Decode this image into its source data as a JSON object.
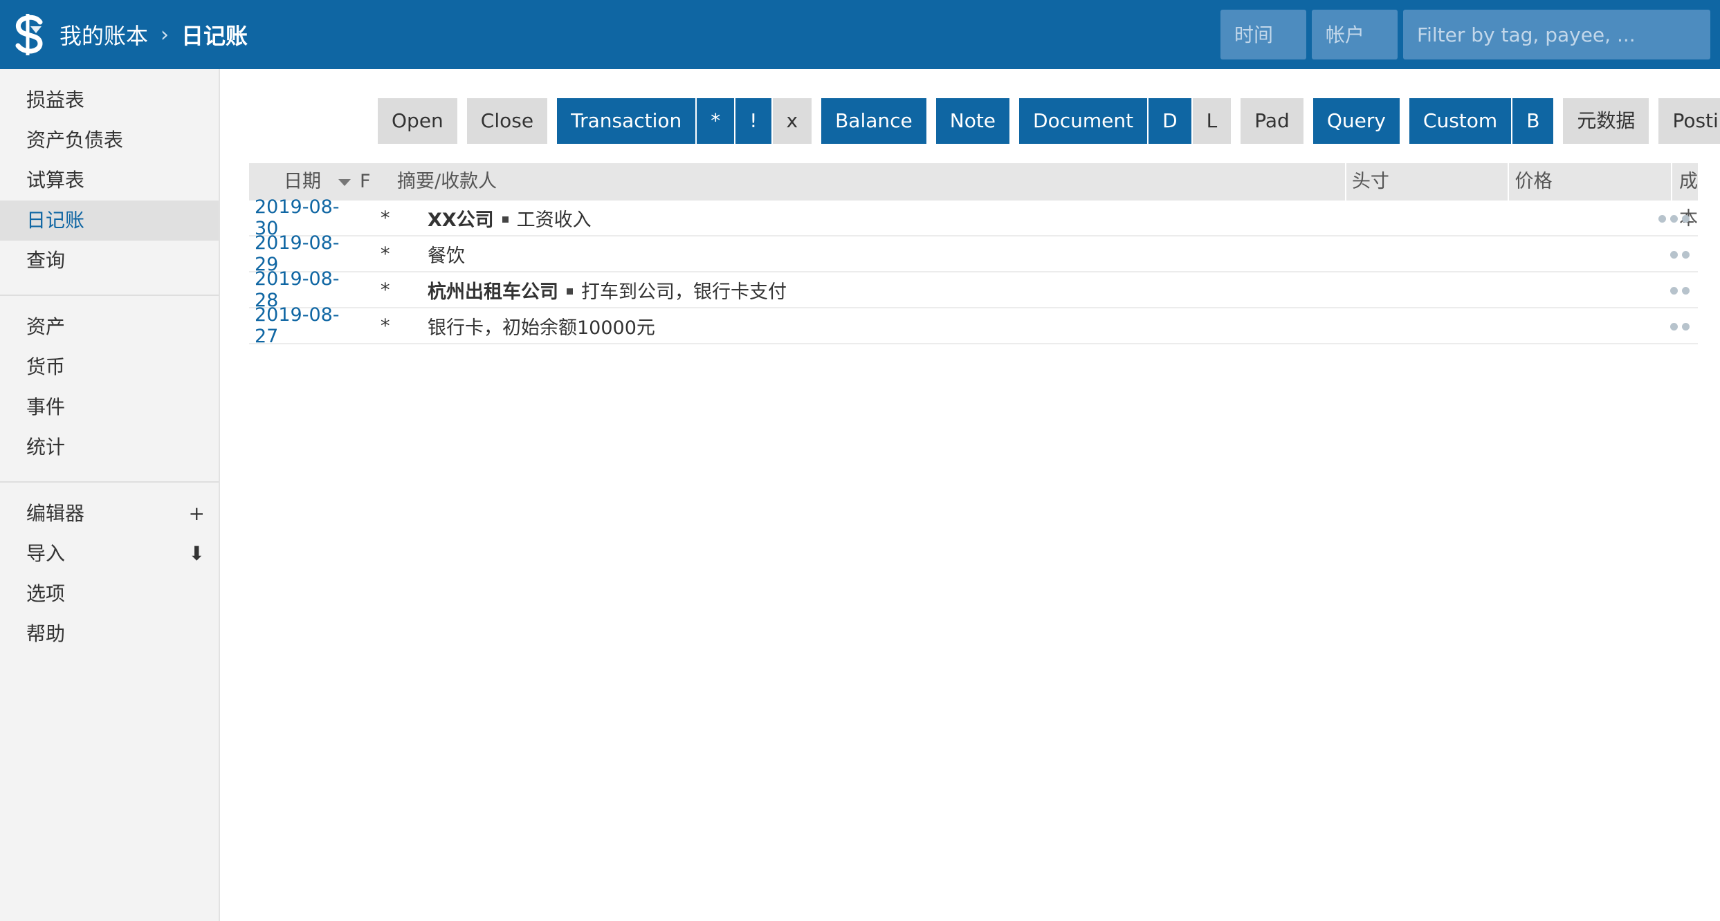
{
  "header": {
    "app_title": "我的账本",
    "separator": "›",
    "page_title": "日记账",
    "time_placeholder": "时间",
    "account_placeholder": "帐户",
    "filter_placeholder": "Filter by tag, payee, ..."
  },
  "sidebar": {
    "group1": [
      "损益表",
      "资产负债表",
      "试算表",
      "日记账",
      "查询"
    ],
    "group2": [
      "资产",
      "货币",
      "事件",
      "统计"
    ],
    "group3": {
      "editor": "编辑器",
      "editor_icon": "+",
      "import": "导入",
      "import_icon": "⬇",
      "options": "选项",
      "help": "帮助"
    }
  },
  "filters": {
    "open": "Open",
    "close": "Close",
    "transaction": "Transaction",
    "flag_star": "*",
    "flag_bang": "!",
    "flag_x": "x",
    "balance": "Balance",
    "note": "Note",
    "document": "Document",
    "doc_d": "D",
    "doc_l": "L",
    "pad": "Pad",
    "query": "Query",
    "custom": "Custom",
    "custom_b": "B",
    "metadata": "元数据",
    "postings": "Postings"
  },
  "table": {
    "columns": {
      "date": "日期",
      "flag": "F",
      "narration": "摘要/收款人",
      "position": "头寸",
      "price": "价格",
      "cost": "成本"
    },
    "rows": [
      {
        "date": "2019-08-30",
        "flag": "*",
        "payee": "XX公司",
        "narration": "工资收入"
      },
      {
        "date": "2019-08-29",
        "flag": "*",
        "payee": "",
        "narration": "餐饮"
      },
      {
        "date": "2019-08-28",
        "flag": "*",
        "payee": "杭州出租车公司",
        "narration": "打车到公司，银行卡支付"
      },
      {
        "date": "2019-08-27",
        "flag": "*",
        "payee": "",
        "narration": "银行卡，初始余额10000元"
      }
    ]
  },
  "colors": {
    "primary": "#0f66a3",
    "header_input": "#4d8cbf",
    "button_off": "#dcdcdc",
    "sidebar_bg": "#f3f3f3"
  }
}
